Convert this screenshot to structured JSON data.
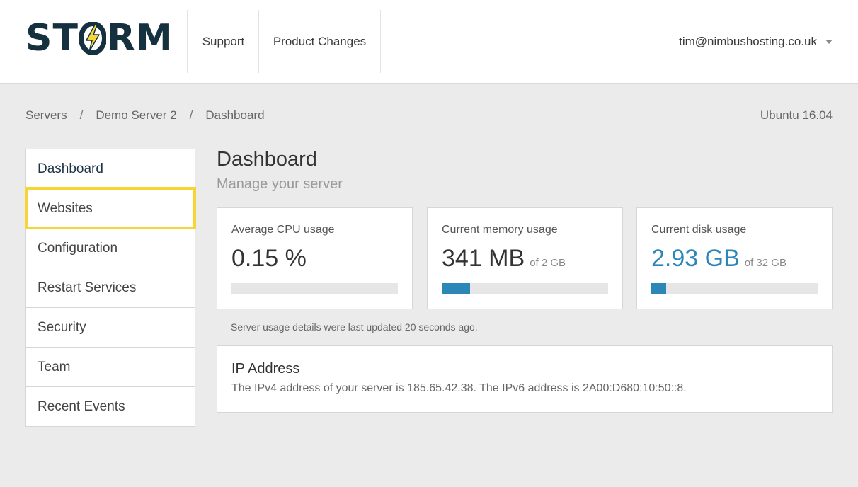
{
  "header": {
    "logo_text_left": "ST",
    "logo_text_right": "RM",
    "nav": [
      {
        "label": "Support"
      },
      {
        "label": "Product Changes"
      }
    ],
    "user_email": "tim@nimbushosting.co.uk"
  },
  "breadcrumb": {
    "items": [
      "Servers",
      "Demo Server 2",
      "Dashboard"
    ],
    "separator": "/"
  },
  "os_version": "Ubuntu 16.04",
  "sidebar": {
    "items": [
      {
        "label": "Dashboard",
        "active": true
      },
      {
        "label": "Websites",
        "highlighted": true
      },
      {
        "label": "Configuration"
      },
      {
        "label": "Restart Services"
      },
      {
        "label": "Security"
      },
      {
        "label": "Team"
      },
      {
        "label": "Recent Events"
      }
    ]
  },
  "main": {
    "title": "Dashboard",
    "subtitle": "Manage your server",
    "cards": {
      "cpu": {
        "label": "Average CPU usage",
        "value": "0.15 %",
        "of": "",
        "usage_fraction": 0.0
      },
      "memory": {
        "label": "Current memory usage",
        "value": "341 MB",
        "of": "of 2 GB",
        "usage_fraction": 0.17
      },
      "disk": {
        "label": "Current disk usage",
        "value": "2.93 GB",
        "of": "of 32 GB",
        "usage_fraction": 0.09
      }
    },
    "updated_note": "Server usage details were last updated 20 seconds ago.",
    "ip": {
      "title": "IP Address",
      "text": "The IPv4 address of your server is 185.65.42.38. The IPv6 address is 2A00:D680:10:50::8."
    }
  },
  "colors": {
    "brand_dark": "#15303f",
    "brand_yellow": "#f6d535",
    "accent_blue": "#2c86b8",
    "background": "#ebebeb"
  },
  "icons": {
    "logo_bolt": "lightning-bolt-icon",
    "user_menu": "caret-down-icon"
  }
}
